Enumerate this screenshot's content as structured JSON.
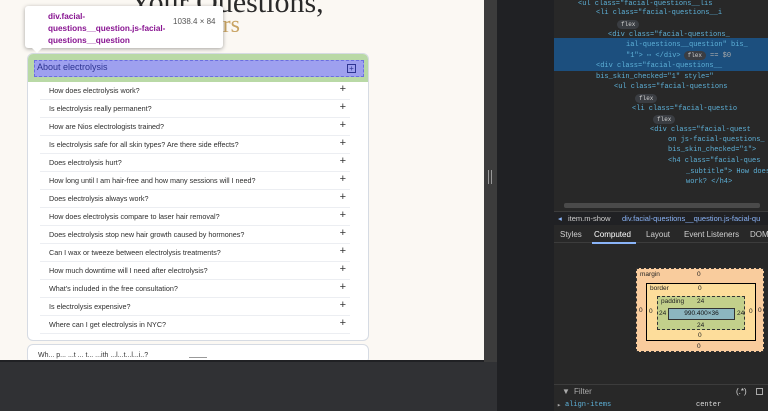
{
  "page": {
    "hero_title_left": "Your ",
    "hero_title_right": "Questions,",
    "hero_sub": "vers",
    "faq_group_title": "About electrolysis",
    "questions": [
      "How does electrolysis work?",
      "Is electrolysis really permanent?",
      "How are Nios electrologists trained?",
      "Is electrolysis safe for all skin types? Are there side effects?",
      "Does electrolysis hurt?",
      "How long until I am hair-free and how many sessions will I need?",
      "Does electrolysis always work?",
      "How does electrolysis compare to laser hair removal?",
      "Does electrolysis stop new hair growth caused by hormones?",
      "Can I wax or tweeze between electrolysis treatments?",
      "How much downtime will I need after electrolysis?",
      "What's included in the free consultation?",
      "Is electrolysis expensive?",
      "Where can I get electrolysis in NYC?"
    ],
    "plus_symbol": "+",
    "next_card_text": "Wh... p... ...t ... t... ...ith ...l...t...l...i..?"
  },
  "tooltip": {
    "selector": "div.facial-questions__question.js-facial-questions__question",
    "dimensions": "1038.4 × 84"
  },
  "devtools": {
    "dom_lines": [
      {
        "indent": 8,
        "text": "<ul class=\"facial-questions__lis"
      },
      {
        "indent": 14,
        "text": "<li class=\"facial-questions__i"
      },
      {
        "indent": 20,
        "pill": "flex"
      },
      {
        "indent": 18,
        "text": "<div class=\"facial-questions_"
      },
      {
        "indent": 24,
        "text": "ial-questions__question\" bis_"
      },
      {
        "indent": 24,
        "text": "\"1\"> ⋯ </div>",
        "pill": "flex",
        "suffix": "== $0"
      },
      {
        "indent": 14,
        "text": "<div class=\"facial-questions__"
      },
      {
        "indent": 14,
        "text": "bis_skin_checked=\"1\" style=\""
      },
      {
        "indent": 20,
        "text": "<ul class=\"facial-questions"
      },
      {
        "indent": 26,
        "pill": "flex"
      },
      {
        "indent": 26,
        "text": "<li class=\"facial-questio"
      },
      {
        "indent": 32,
        "pill": "flex"
      },
      {
        "indent": 32,
        "text": "<div class=\"facial-quest"
      },
      {
        "indent": 38,
        "text": "on js-facial-questions_"
      },
      {
        "indent": 38,
        "text": "bis_skin_checked=\"1\">"
      },
      {
        "indent": 38,
        "text": "<h4 class=\"facial-ques"
      },
      {
        "indent": 44,
        "text": "_subtitle\"> How does e"
      },
      {
        "indent": 44,
        "text": "work? </h4>"
      }
    ],
    "breadcrumb_1": "item.m-show",
    "breadcrumb_2": "div.facial-questions__question.js-facial-qu",
    "tabs": [
      "Styles",
      "Computed",
      "Layout",
      "Event Listeners",
      "DOM"
    ],
    "active_tab": "Computed",
    "box_model": {
      "margin_label": "margin",
      "margin_value": "0",
      "border_label": "border",
      "border_value": "0",
      "padding_label": "padding",
      "padding_value": "24",
      "content": "990.400×36",
      "margin_top": "0",
      "margin_bottom": "0",
      "margin_left": "0",
      "margin_right": "0",
      "border_top": "0",
      "border_left": "0",
      "border_right": "0",
      "border_bottom": "0",
      "padding_left": "24",
      "padding_right": "24",
      "padding_bottom": "24"
    },
    "filter_placeholder": "Filter",
    "prop_name": "align-items",
    "prop_value": "center"
  }
}
